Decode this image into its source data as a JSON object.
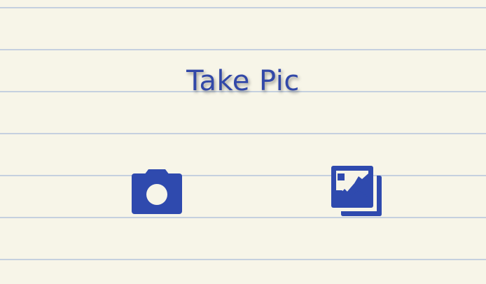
{
  "app": {
    "title": "Take Pic"
  },
  "actions": [
    {
      "icon": "camera-icon",
      "label": ""
    },
    {
      "icon": "photo-library-icon",
      "label": ""
    }
  ],
  "colors": {
    "background": "#f7f5e8",
    "rule_line": "#c5d0df",
    "accent": "#3248a8",
    "icon": "#2f4aae"
  }
}
